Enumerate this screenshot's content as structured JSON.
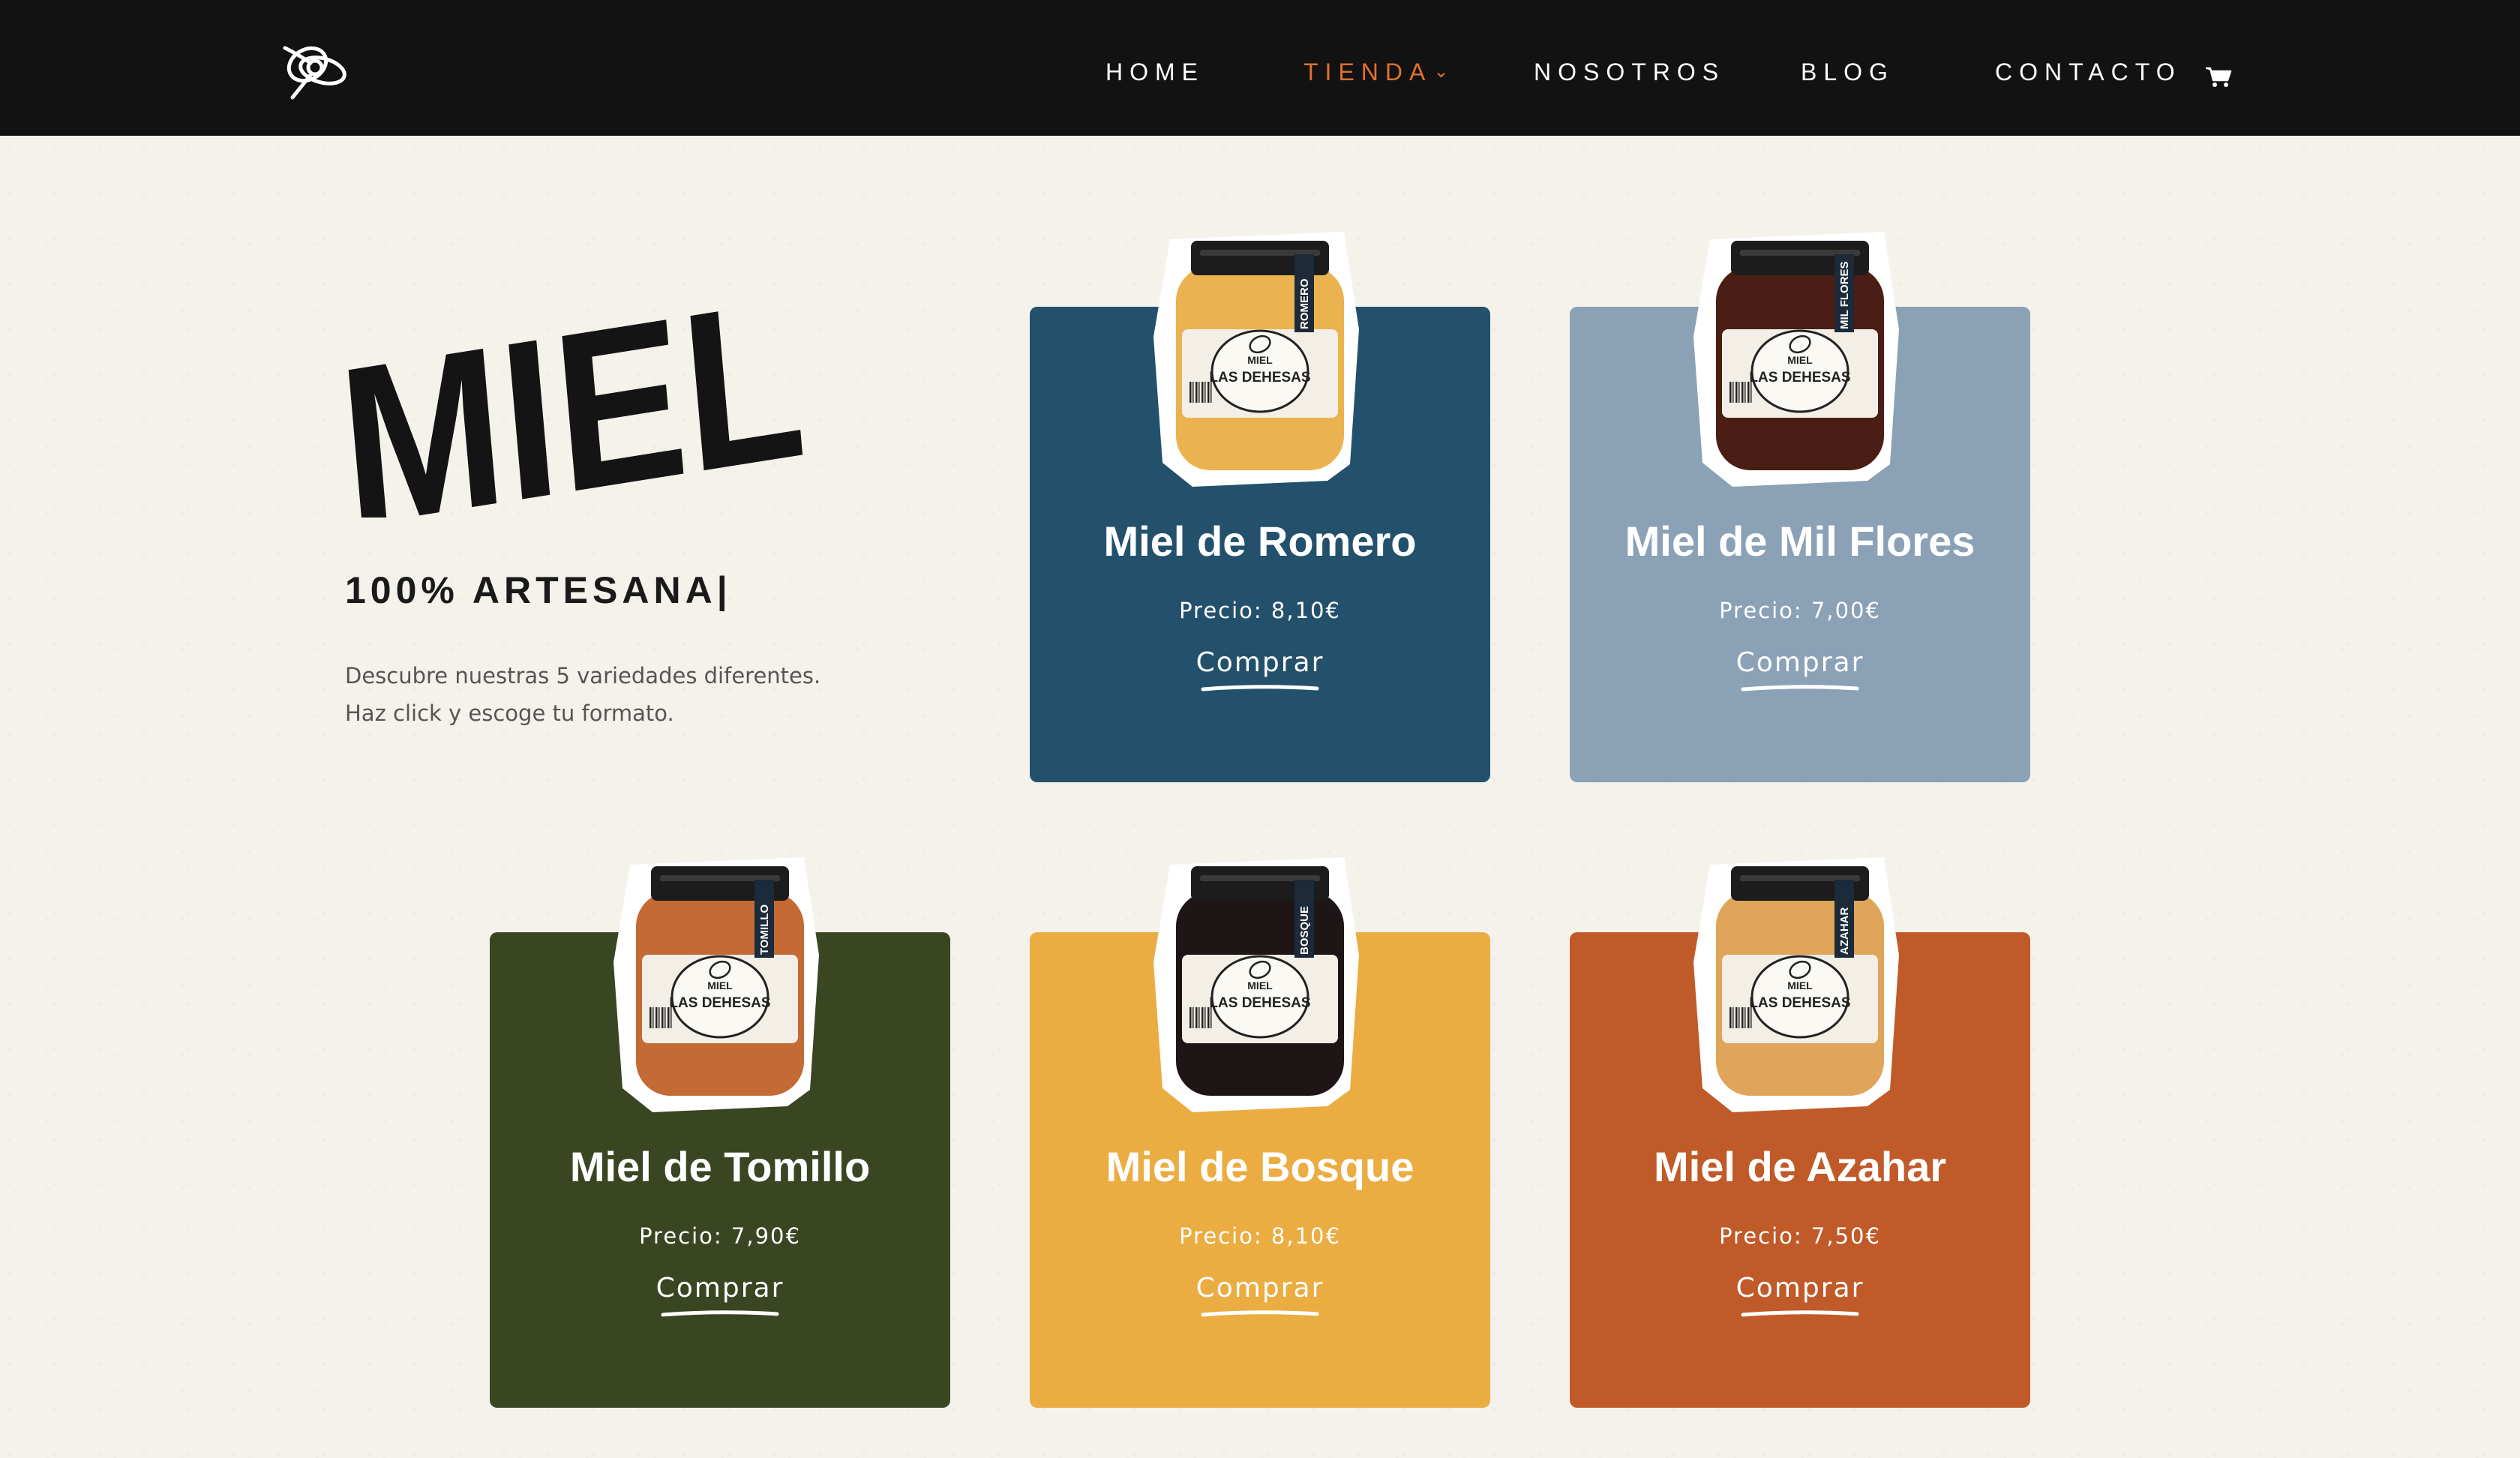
{
  "nav": {
    "items": [
      {
        "label": "HOME",
        "active": false
      },
      {
        "label": "TIENDA",
        "active": true,
        "has_dropdown": true
      },
      {
        "label": "NOSOTROS",
        "active": false
      },
      {
        "label": "BLOG",
        "active": false
      },
      {
        "label": "CONTACTO",
        "active": false
      }
    ],
    "cart_icon": "shopping-cart-icon",
    "logo_icon": "bee-logo-icon",
    "colors": {
      "background": "#121212",
      "text": "#ffffff",
      "active": "#e0702c"
    }
  },
  "hero": {
    "title": "MIEL",
    "tagline": "100% ARTESANA|",
    "description": [
      "Descubre nuestras 5 variedades diferentes.",
      "Haz click y escoge tu formato."
    ]
  },
  "products": [
    {
      "name": "Miel de Romero",
      "price": "Precio: 8,10€",
      "buy_label": "Comprar",
      "jar_label": "ROMERO",
      "card_color": "#23516c",
      "honey_color": "#eab34f",
      "lid_color": "#1c1c1c"
    },
    {
      "name": "Miel de Mil Flores",
      "price": "Precio: 7,00€",
      "buy_label": "Comprar",
      "jar_label": "MIL FLORES",
      "card_color": "#8aa1b6",
      "honey_color": "#4a1e14",
      "lid_color": "#1c1c1c"
    },
    {
      "name": "Miel de Tomillo",
      "price": "Precio: 7,90€",
      "buy_label": "Comprar",
      "jar_label": "TOMILLO",
      "card_color": "#3a4521",
      "honey_color": "#c46a35",
      "lid_color": "#1c1c1c"
    },
    {
      "name": "Miel de Bosque",
      "price": "Precio: 8,10€",
      "buy_label": "Comprar",
      "jar_label": "BOSQUE",
      "card_color": "#ebac42",
      "honey_color": "#1e1616",
      "lid_color": "#1c1c1c"
    },
    {
      "name": "Miel de Azahar",
      "price": "Precio: 7,50€",
      "buy_label": "Comprar",
      "jar_label": "AZAHAR",
      "card_color": "#c05a28",
      "honey_color": "#dfa55a",
      "lid_color": "#1c1c1c"
    }
  ],
  "jar_brand": {
    "line1": "MIEL",
    "line2": "LAS DEHESAS"
  }
}
